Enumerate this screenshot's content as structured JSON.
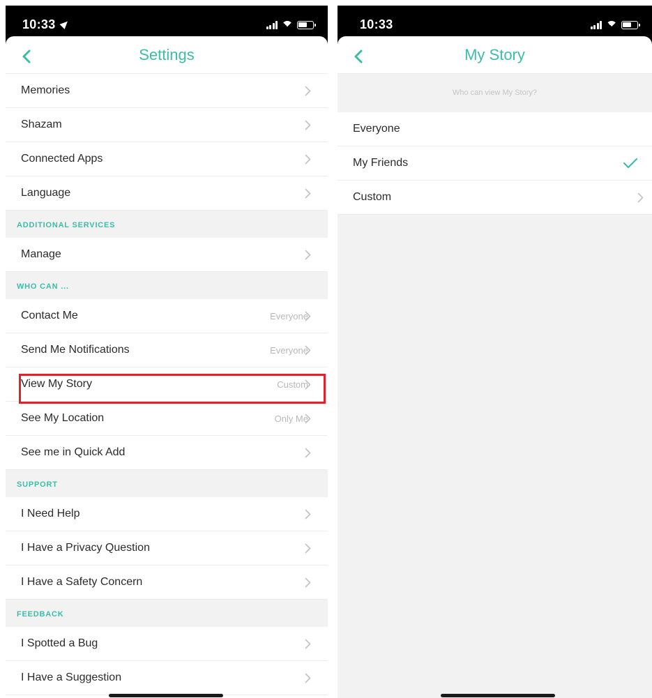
{
  "left_screen": {
    "status_time": "10:33",
    "title": "Settings",
    "rows": [
      {
        "type": "item",
        "label": "Memories",
        "value": ""
      },
      {
        "type": "item",
        "label": "Shazam",
        "value": ""
      },
      {
        "type": "item",
        "label": "Connected Apps",
        "value": ""
      },
      {
        "type": "item",
        "label": "Language",
        "value": ""
      },
      {
        "type": "header",
        "label": "ADDITIONAL SERVICES"
      },
      {
        "type": "item",
        "label": "Manage",
        "value": ""
      },
      {
        "type": "header",
        "label": "WHO CAN ..."
      },
      {
        "type": "item",
        "label": "Contact Me",
        "value": "Everyone"
      },
      {
        "type": "item",
        "label": "Send Me Notifications",
        "value": "Everyone"
      },
      {
        "type": "item",
        "label": "View My Story",
        "value": "Custom",
        "highlighted": true
      },
      {
        "type": "item",
        "label": "See My Location",
        "value": "Only Me"
      },
      {
        "type": "item",
        "label": "See me in Quick Add",
        "value": ""
      },
      {
        "type": "header",
        "label": "SUPPORT"
      },
      {
        "type": "item",
        "label": "I Need Help",
        "value": ""
      },
      {
        "type": "item",
        "label": "I Have a Privacy Question",
        "value": ""
      },
      {
        "type": "item",
        "label": "I Have a Safety Concern",
        "value": ""
      },
      {
        "type": "header",
        "label": "FEEDBACK"
      },
      {
        "type": "item",
        "label": "I Spotted a Bug",
        "value": ""
      },
      {
        "type": "item",
        "label": "I Have a Suggestion",
        "value": ""
      }
    ]
  },
  "right_screen": {
    "status_time": "10:33",
    "title": "My Story",
    "question": "Who can view My Story?",
    "options": [
      {
        "label": "Everyone",
        "selected": false,
        "has_chevron": false
      },
      {
        "label": "My Friends",
        "selected": true,
        "has_chevron": false
      },
      {
        "label": "Custom",
        "selected": false,
        "has_chevron": true
      }
    ]
  },
  "colors": {
    "accent": "#3dbda8",
    "highlight_border": "#e3212a",
    "section_background": "#f2f2f2"
  },
  "icons": [
    "location-arrow-icon",
    "cellular-signal-icon",
    "wifi-icon",
    "battery-icon",
    "back-chevron-icon",
    "chevron-right-icon",
    "checkmark-icon"
  ]
}
